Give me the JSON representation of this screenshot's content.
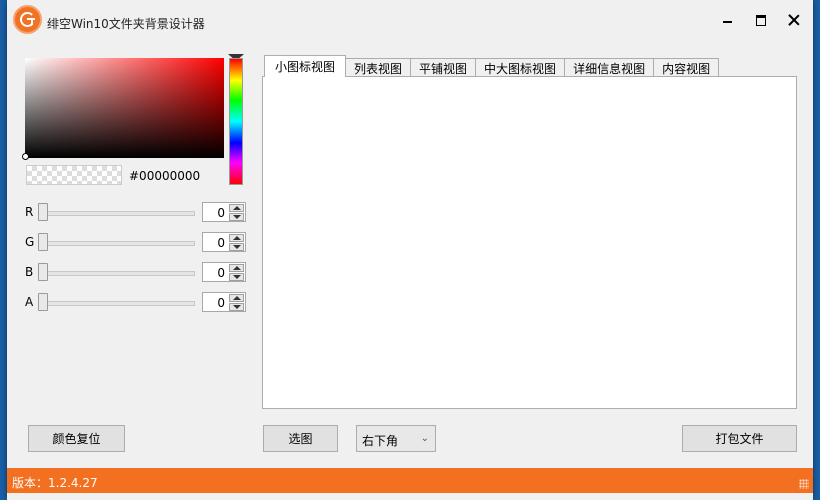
{
  "window": {
    "title": "绯空Win10文件夹背景设计器"
  },
  "color_picker": {
    "hex": "#00000000",
    "sliders": [
      {
        "label": "R",
        "value": "0"
      },
      {
        "label": "G",
        "value": "0"
      },
      {
        "label": "B",
        "value": "0"
      },
      {
        "label": "A",
        "value": "0"
      }
    ],
    "reset_label": "颜色复位"
  },
  "tabs": [
    {
      "label": "小图标视图",
      "active": true
    },
    {
      "label": "列表视图",
      "active": false
    },
    {
      "label": "平铺视图",
      "active": false
    },
    {
      "label": "中大图标视图",
      "active": false
    },
    {
      "label": "详细信息视图",
      "active": false
    },
    {
      "label": "内容视图",
      "active": false
    }
  ],
  "controls": {
    "choose_image_label": "选图",
    "position_select": "右下角",
    "pack_label": "打包文件"
  },
  "status": {
    "version": "版本：1.2.4.27"
  },
  "colors": {
    "accent": "#f37021",
    "logo": "#f07225"
  }
}
